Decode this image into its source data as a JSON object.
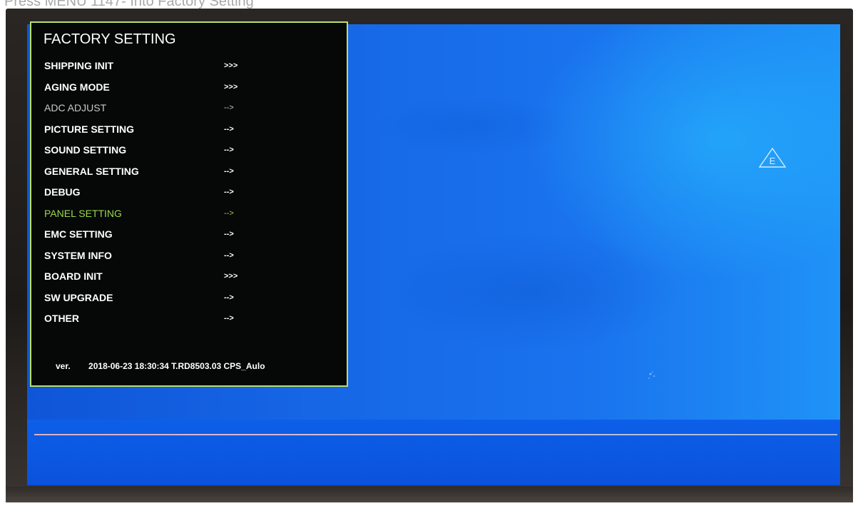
{
  "caption": "Press MENU 1147- Into Factory Setting",
  "osd": {
    "title": "FACTORY SETTING",
    "selected_item": "PANEL SETTING",
    "items": [
      {
        "label": "SHIPPING INIT",
        "arrow": ">>>"
      },
      {
        "label": "AGING MODE",
        "arrow": ">>>"
      },
      {
        "label": "ADC ADJUST",
        "arrow": "-->"
      },
      {
        "label": "PICTURE SETTING",
        "arrow": "-->"
      },
      {
        "label": "SOUND SETTING",
        "arrow": "-->"
      },
      {
        "label": "GENERAL SETTING",
        "arrow": "-->"
      },
      {
        "label": "DEBUG",
        "arrow": "-->"
      },
      {
        "label": "PANEL SETTING",
        "arrow": "-->"
      },
      {
        "label": "EMC SETTING",
        "arrow": "-->"
      },
      {
        "label": "SYSTEM INFO",
        "arrow": "-->"
      },
      {
        "label": "BOARD INIT",
        "arrow": ">>>"
      },
      {
        "label": "SW UPGRADE",
        "arrow": "-->"
      },
      {
        "label": "OTHER",
        "arrow": "-->"
      }
    ],
    "version": {
      "label": "ver.",
      "value": "2018-06-23 18:30:34  T.RD8503.03  CPS_Aulo"
    }
  },
  "icons": {
    "warning_label": "E"
  },
  "colors": {
    "osd_border": "#b9e06a",
    "selected_text": "#9bd84c",
    "screen_blue": "#1666e6"
  }
}
